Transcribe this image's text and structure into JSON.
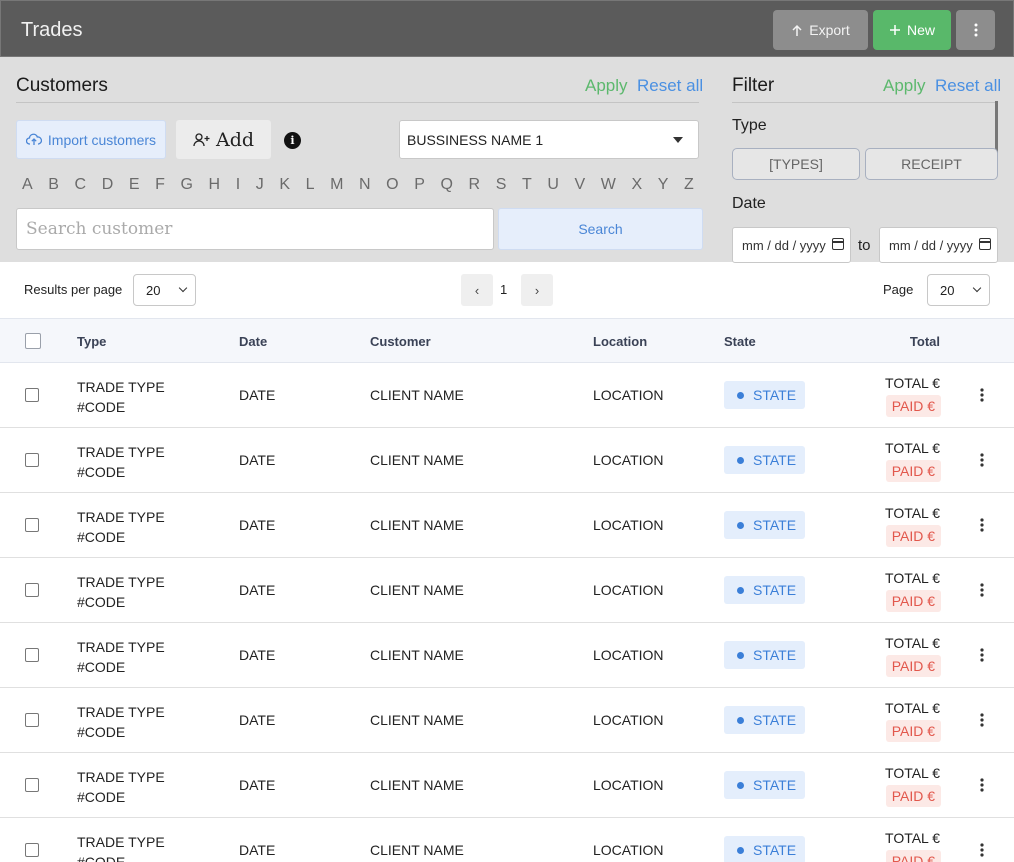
{
  "header": {
    "title": "Trades",
    "export_label": "Export",
    "new_label": "New",
    "more_icon": "more-vertical-icon"
  },
  "customers": {
    "title": "Customers",
    "apply_label": "Apply",
    "reset_label": "Reset all",
    "import_label": "Import customers",
    "add_label": "Add",
    "business_select": "BUSSINESS NAME 1",
    "alphabet": [
      "A",
      "B",
      "C",
      "D",
      "E",
      "F",
      "G",
      "H",
      "I",
      "J",
      "K",
      "L",
      "M",
      "N",
      "O",
      "P",
      "Q",
      "R",
      "S",
      "T",
      "U",
      "V",
      "W",
      "X",
      "Y",
      "Z"
    ],
    "search_placeholder": "Search customer",
    "search_label": "Search"
  },
  "filter": {
    "title": "Filter",
    "apply_label": "Apply",
    "reset_label": "Reset all",
    "type_label": "Type",
    "type_options": [
      "[TYPES]",
      "RECEIPT"
    ],
    "date_label": "Date",
    "date_from": "mm / dd / yyyy",
    "date_to": "mm / dd / yyyy",
    "to_label": "to"
  },
  "pagination": {
    "results_label": "Results per page",
    "results_value": "20",
    "prev": "‹",
    "current": "1",
    "next": "›",
    "page_label": "Page",
    "page_value": "20"
  },
  "table": {
    "columns": [
      "Type",
      "Date",
      "Customer",
      "Location",
      "State",
      "Total"
    ],
    "rows": [
      {
        "type": "TRADE TYPE",
        "code": "#CODE",
        "date": "DATE",
        "customer": "CLIENT NAME",
        "location": "LOCATION",
        "state": "STATE",
        "total": "TOTAL €",
        "paid": "PAID €"
      },
      {
        "type": "TRADE TYPE",
        "code": "#CODE",
        "date": "DATE",
        "customer": "CLIENT NAME",
        "location": "LOCATION",
        "state": "STATE",
        "total": "TOTAL €",
        "paid": "PAID €"
      },
      {
        "type": "TRADE TYPE",
        "code": "#CODE",
        "date": "DATE",
        "customer": "CLIENT NAME",
        "location": "LOCATION",
        "state": "STATE",
        "total": "TOTAL €",
        "paid": "PAID €"
      },
      {
        "type": "TRADE TYPE",
        "code": "#CODE",
        "date": "DATE",
        "customer": "CLIENT NAME",
        "location": "LOCATION",
        "state": "STATE",
        "total": "TOTAL €",
        "paid": "PAID €"
      },
      {
        "type": "TRADE TYPE",
        "code": "#CODE",
        "date": "DATE",
        "customer": "CLIENT NAME",
        "location": "LOCATION",
        "state": "STATE",
        "total": "TOTAL €",
        "paid": "PAID €"
      },
      {
        "type": "TRADE TYPE",
        "code": "#CODE",
        "date": "DATE",
        "customer": "CLIENT NAME",
        "location": "LOCATION",
        "state": "STATE",
        "total": "TOTAL €",
        "paid": "PAID €"
      },
      {
        "type": "TRADE TYPE",
        "code": "#CODE",
        "date": "DATE",
        "customer": "CLIENT NAME",
        "location": "LOCATION",
        "state": "STATE",
        "total": "TOTAL €",
        "paid": "PAID €"
      },
      {
        "type": "TRADE TYPE",
        "code": "#CODE",
        "date": "DATE",
        "customer": "CLIENT NAME",
        "location": "LOCATION",
        "state": "STATE",
        "total": "TOTAL €",
        "paid": "PAID €"
      }
    ]
  },
  "colors": {
    "header_bg": "#5b5b5b",
    "panel_bg": "#dedede",
    "new_green": "#59b86a",
    "link_blue": "#4a90e2",
    "state_blue": "#3b7fd8",
    "paid_red": "#e2574c"
  }
}
